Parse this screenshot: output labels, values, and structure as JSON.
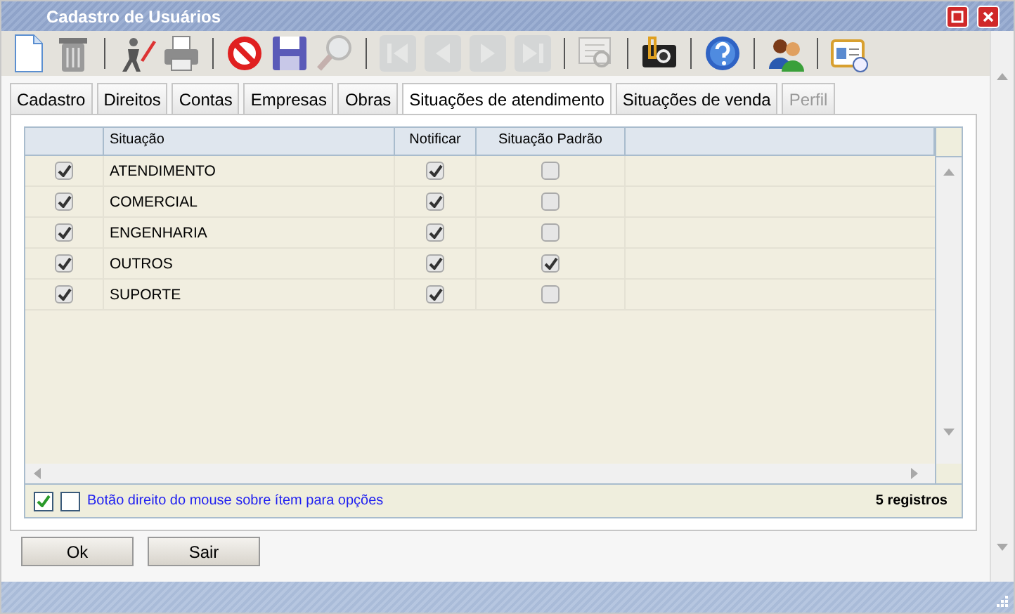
{
  "window": {
    "title": "Cadastro de Usuários"
  },
  "toolbar": [
    [
      {
        "kind": "new",
        "disabled": false
      },
      {
        "kind": "delete",
        "disabled": false
      }
    ],
    [
      {
        "kind": "edit",
        "disabled": false
      },
      {
        "kind": "print",
        "disabled": false
      }
    ],
    [
      {
        "kind": "cancel",
        "disabled": false
      },
      {
        "kind": "save",
        "disabled": false
      },
      {
        "kind": "search",
        "disabled": true
      }
    ],
    [
      {
        "kind": "first",
        "disabled": true
      },
      {
        "kind": "prev",
        "disabled": true
      },
      {
        "kind": "next",
        "disabled": true
      },
      {
        "kind": "last",
        "disabled": true
      }
    ],
    [
      {
        "kind": "preview",
        "disabled": true
      }
    ],
    [
      {
        "kind": "camera",
        "disabled": false
      }
    ],
    [
      {
        "kind": "help",
        "disabled": false
      }
    ],
    [
      {
        "kind": "users",
        "disabled": false
      }
    ],
    [
      {
        "kind": "card",
        "disabled": false
      }
    ]
  ],
  "tabs": [
    {
      "label": "Cadastro",
      "selected": false,
      "disabled": false
    },
    {
      "label": "Direitos",
      "selected": false,
      "disabled": false
    },
    {
      "label": "Contas",
      "selected": false,
      "disabled": false
    },
    {
      "label": "Empresas",
      "selected": false,
      "disabled": false
    },
    {
      "label": "Obras",
      "selected": false,
      "disabled": false
    },
    {
      "label": "Situações de atendimento",
      "selected": true,
      "disabled": false
    },
    {
      "label": "Situações de venda",
      "selected": false,
      "disabled": false
    },
    {
      "label": "Perfil",
      "selected": false,
      "disabled": true
    }
  ],
  "table": {
    "columns": [
      "Situação",
      "Notificar",
      "Situação Padrão"
    ],
    "rows": [
      {
        "checked": true,
        "situacao": "ATENDIMENTO",
        "notificar": true,
        "padrao": false
      },
      {
        "checked": true,
        "situacao": "COMERCIAL",
        "notificar": true,
        "padrao": false
      },
      {
        "checked": true,
        "situacao": "ENGENHARIA",
        "notificar": true,
        "padrao": false
      },
      {
        "checked": true,
        "situacao": "OUTROS",
        "notificar": true,
        "padrao": true
      },
      {
        "checked": true,
        "situacao": "SUPORTE",
        "notificar": true,
        "padrao": false
      }
    ]
  },
  "grid_footer": {
    "select_all": true,
    "select_none": false,
    "hint": "Botão direito do mouse sobre ítem para opções",
    "count": "5 registros"
  },
  "buttons": [
    "Ok",
    "Sair"
  ]
}
